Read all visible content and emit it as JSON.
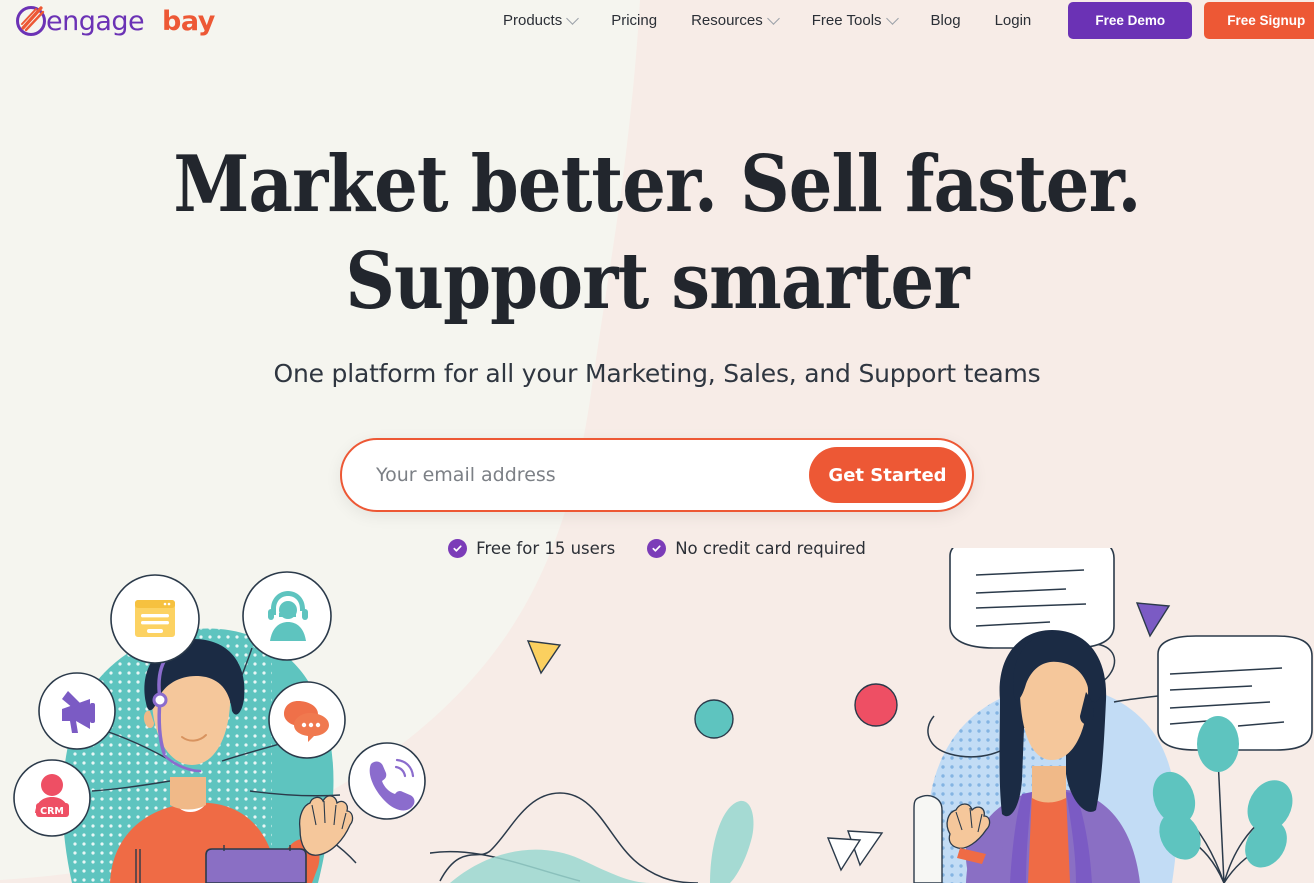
{
  "brand": {
    "name_part1": "engage",
    "name_part2": "bay",
    "purple": "#6b32b5",
    "orange": "#ed5835",
    "logo_icon": "engagebay-swoosh-icon"
  },
  "nav": {
    "items": [
      {
        "label": "Products",
        "has_caret": true
      },
      {
        "label": "Pricing",
        "has_caret": false
      },
      {
        "label": "Resources",
        "has_caret": true
      },
      {
        "label": "Free Tools",
        "has_caret": true
      },
      {
        "label": "Blog",
        "has_caret": false
      },
      {
        "label": "Login",
        "has_caret": false
      }
    ],
    "free_demo_label": "Free Demo",
    "free_signup_label": "Free Signup"
  },
  "hero": {
    "headline_line1": "Market better. Sell faster.",
    "headline_line2": "Support smarter",
    "subheadline": "One platform for all your Marketing, Sales, and Support teams"
  },
  "form": {
    "email_placeholder": "Your email address",
    "email_value": "",
    "submit_label": "Get Started"
  },
  "badges": [
    {
      "label": "Free for 15 users",
      "icon": "check-circle-icon"
    },
    {
      "label": "No credit card required",
      "icon": "check-circle-icon"
    }
  ],
  "illustration": {
    "left": {
      "name": "support-agent-with-feature-bubbles",
      "bubbles": [
        {
          "icon": "megaphone-icon",
          "color": "#7b5bc4"
        },
        {
          "icon": "crm-contact-icon",
          "color": "#ee4f64",
          "label": "CRM"
        },
        {
          "icon": "landing-page-icon",
          "color": "#fcd262"
        },
        {
          "icon": "headset-agent-icon",
          "color": "#5ec4bf"
        },
        {
          "icon": "chat-bubbles-icon",
          "color": "#ef7049"
        },
        {
          "icon": "phone-ring-icon",
          "color": "#8b6ccd"
        }
      ]
    },
    "right": {
      "name": "woman-with-chat-bubbles",
      "shapes": [
        "purple-triangle",
        "red-circle",
        "white-triangle",
        "leaf-plant"
      ]
    },
    "middle": {
      "name": "decorative-shapes",
      "shapes": [
        "yellow-triangle",
        "teal-circle",
        "wave-lines"
      ]
    }
  },
  "colors": {
    "bg_left": "#f5f5ef",
    "bg_right": "#f7ece7",
    "text_dark": "#22262d",
    "teal": "#5ec4bf",
    "navy": "#1f3a52",
    "skin": "#f5c79b",
    "purple_coat": "#8a6fc4",
    "orange_shirt": "#ef6b45",
    "light_blue": "#c2dcf5"
  }
}
